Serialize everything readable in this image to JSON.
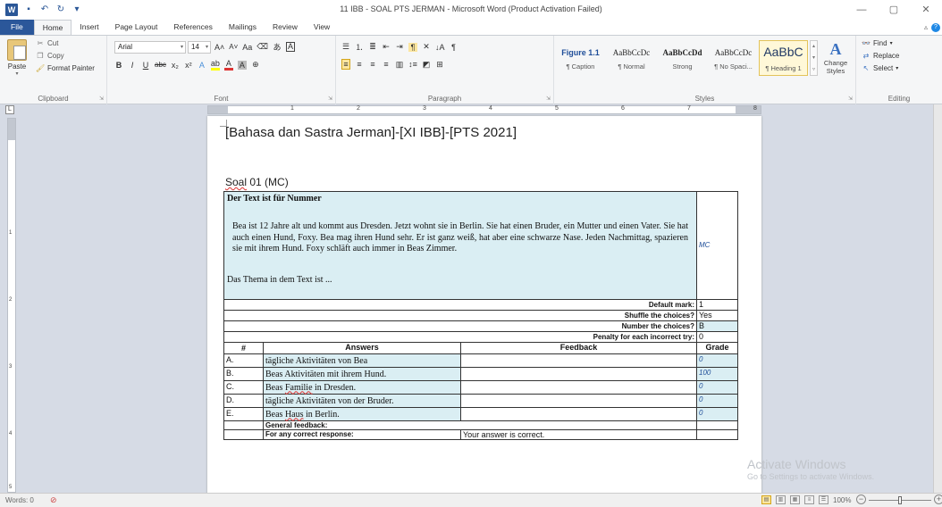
{
  "window": {
    "title": "11 IBB - SOAL PTS JERMAN - Microsoft Word (Product Activation Failed)",
    "logo": "W"
  },
  "tabs": [
    {
      "label": "File"
    },
    {
      "label": "Home"
    },
    {
      "label": "Insert"
    },
    {
      "label": "Page Layout"
    },
    {
      "label": "References"
    },
    {
      "label": "Mailings"
    },
    {
      "label": "Review"
    },
    {
      "label": "View"
    }
  ],
  "ribbon": {
    "clipboard": {
      "label": "Clipboard",
      "paste": "Paste",
      "cut": "Cut",
      "copy": "Copy",
      "format_painter": "Format Painter"
    },
    "font": {
      "label": "Font",
      "font_name": "Arial",
      "font_size": "14"
    },
    "paragraph": {
      "label": "Paragraph"
    },
    "styles": {
      "label": "Styles",
      "tiles": [
        {
          "sample": "Figure 1.1",
          "name": "¶ Caption"
        },
        {
          "sample": "AaBbCcDc",
          "name": "¶ Normal"
        },
        {
          "sample": "AaBbCcDd",
          "name": "Strong"
        },
        {
          "sample": "AaBbCcDc",
          "name": "¶ No Spaci..."
        },
        {
          "sample": "AaBbC",
          "name": "¶ Heading 1"
        }
      ],
      "change_styles": "Change Styles"
    },
    "editing": {
      "label": "Editing",
      "find": "Find",
      "replace": "Replace",
      "select": "Select"
    }
  },
  "ruler": {
    "numbers": [
      "1",
      "2",
      "3",
      "4",
      "5",
      "6",
      "7",
      "8"
    ]
  },
  "vruler": {
    "numbers": [
      "1",
      "2",
      "3",
      "4",
      "5"
    ]
  },
  "document": {
    "title": "[Bahasa dan Sastra Jerman]-[XI IBB]-[PTS 2021]",
    "soal_prefix": "Soal",
    "soal_suffix": " 01 (MC)",
    "question": {
      "heading": "Der Text ist für Nummer",
      "paragraph": "Bea ist 12 Jahre alt und kommt aus Dresden. Jetzt wohnt sie in Berlin. Sie hat einen Bruder, ein Mutter und einen Vater. Sie hat auch einen Hund, Foxy.  Bea mag ihren Hund sehr. Er ist ganz weiß, hat aber eine schwarze Nase. Jeden Nachmittag, spazieren sie mit ihrem Hund. Foxy schläft auch immer in Beas Zimmer.",
      "prompt": "Das Thema in dem Text ist ...",
      "type": "MC"
    },
    "settings": [
      {
        "label": "Default mark:",
        "value": "1",
        "highlight": false
      },
      {
        "label": "Shuffle the choices?",
        "value": "Yes",
        "highlight": false
      },
      {
        "label": "Number the choices?",
        "value": "B",
        "highlight": true
      },
      {
        "label": "Penalty for each incorrect try:",
        "value": "0",
        "highlight": false
      }
    ],
    "answer_headers": {
      "num": "#",
      "answers": "Answers",
      "feedback": "Feedback",
      "grade": "Grade"
    },
    "answers": [
      {
        "letter": "A.",
        "pre": "tägliche Aktivitäten von Bea",
        "u": "",
        "post": "",
        "grade": "0"
      },
      {
        "letter": "B.",
        "pre": "Beas Aktivitäten mit ihrem  Hund.",
        "u": "",
        "post": "",
        "grade": "100"
      },
      {
        "letter": "C.",
        "pre": "Beas ",
        "u": "Familie",
        "post": " in Dresden.",
        "grade": "0"
      },
      {
        "letter": "D.",
        "pre": "tägliche Aktivitäten von der Bruder.",
        "u": "",
        "post": "",
        "grade": "0"
      },
      {
        "letter": "E.",
        "pre": "Beas ",
        "u": "Haus",
        "post": " in Berlin.",
        "grade": "0"
      }
    ],
    "general_feedback": "General feedback:",
    "correct_response": "For any correct response:",
    "correct_feedback": "Your answer is correct."
  },
  "watermark": {
    "line1": "Activate Windows",
    "line2": "Go to Settings to activate Windows."
  },
  "status": {
    "words": "Words: 0",
    "zoom": "100%",
    "zoom_level_percent": 100
  }
}
